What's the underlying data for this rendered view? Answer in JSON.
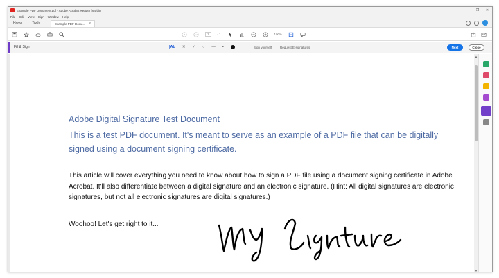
{
  "window": {
    "title": "Example PDF Document.pdf - Adobe Acrobat Reader (64-bit)",
    "controls": [
      "–",
      "❐",
      "✕"
    ]
  },
  "menu": [
    "File",
    "Edit",
    "View",
    "Sign",
    "Window",
    "Help"
  ],
  "tabs": {
    "home": "Home",
    "tools": "Tools",
    "document": "Example PDF Docu...",
    "close": "×"
  },
  "toolbar": {
    "page_current": "1",
    "page_total": "/ 1",
    "zoom": "100%"
  },
  "fill_sign": {
    "title": "Fill & Sign",
    "text_tool": "|Ab",
    "cross_tool": "✕",
    "check_tool": "✓",
    "circle_tool": "○",
    "line_tool": "—",
    "dot_tool": "•",
    "sign_yourself": "Sign yourself",
    "request_signatures": "Request E-signatures",
    "next": "Next",
    "close": "Close"
  },
  "colors": {
    "accent_purple": "#6f3cc8",
    "blue_button": "#1473e6",
    "heading_blue": "#4d6aa3"
  },
  "document": {
    "title": "Adobe Digital Signature Test Document",
    "subtitle": "This is a test PDF document. It's meant to serve as an example of a PDF file that can be digitally signed using a document signing certificate.",
    "body": "This article will cover everything you need to know about how to sign a PDF file using a document signing certificate in Adobe Acrobat. It'll also differentiate between a digital signature and an electronic signature. (Hint: All digital signatures are electronic signatures, but not all electronic signatures are digital signatures.)",
    "woohoo": "Woohoo! Let's get right to it..."
  }
}
